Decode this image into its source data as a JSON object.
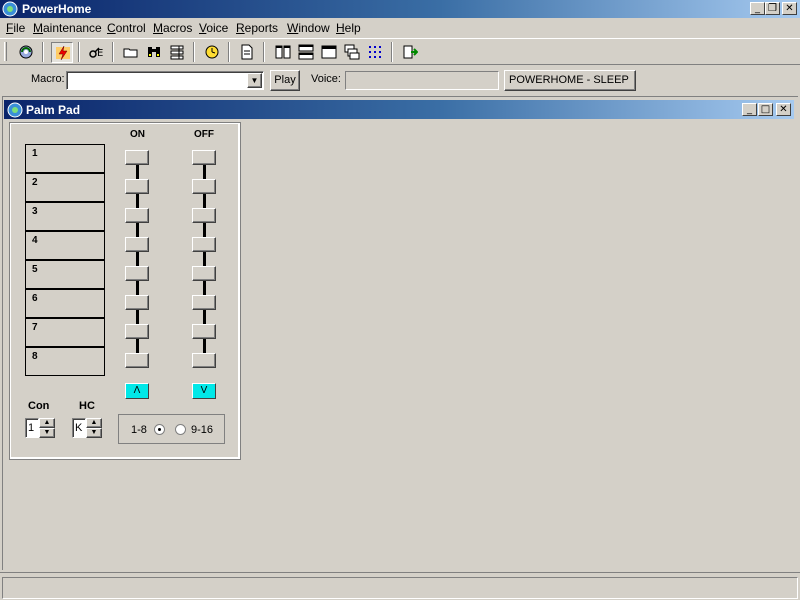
{
  "app": {
    "title": "PowerHome"
  },
  "menu": [
    {
      "pre": "",
      "ul": "F",
      "post": "ile"
    },
    {
      "pre": "",
      "ul": "M",
      "post": "aintenance"
    },
    {
      "pre": "",
      "ul": "C",
      "post": "ontrol"
    },
    {
      "pre": "",
      "ul": "M",
      "post": "acros"
    },
    {
      "pre": "",
      "ul": "V",
      "post": "oice"
    },
    {
      "pre": "",
      "ul": "R",
      "post": "eports"
    },
    {
      "pre": "",
      "ul": "W",
      "post": "indow"
    },
    {
      "pre": "",
      "ul": "H",
      "post": "elp"
    }
  ],
  "toolbar": {
    "icons": [
      "refresh-icon",
      "lightning-icon",
      "event-icon",
      "folder-icon",
      "binoculars-icon",
      "list-icon",
      "clock-icon",
      "document-icon",
      "tile-vertical-icon",
      "tile-horizontal-icon",
      "window-icon",
      "cascade-icon",
      "arrange-icon",
      "exit-icon"
    ]
  },
  "macrobar": {
    "macro_label": "Macro:",
    "macro_value": "",
    "play_label": "Play",
    "voice_label": "Voice:",
    "voice_value": "",
    "status_button": "POWERHOME - SLEEP"
  },
  "child": {
    "title": "Palm Pad"
  },
  "palmpad": {
    "on_label": "ON",
    "off_label": "OFF",
    "units": [
      "1",
      "2",
      "3",
      "4",
      "5",
      "6",
      "7",
      "8"
    ],
    "up_label": "Λ",
    "down_label": "V",
    "con_label": "Con",
    "con_value": "1",
    "hc_label": "HC",
    "hc_value": "K",
    "range1_label": "1-8",
    "range2_label": "9-16",
    "selected_range": "1-8"
  }
}
